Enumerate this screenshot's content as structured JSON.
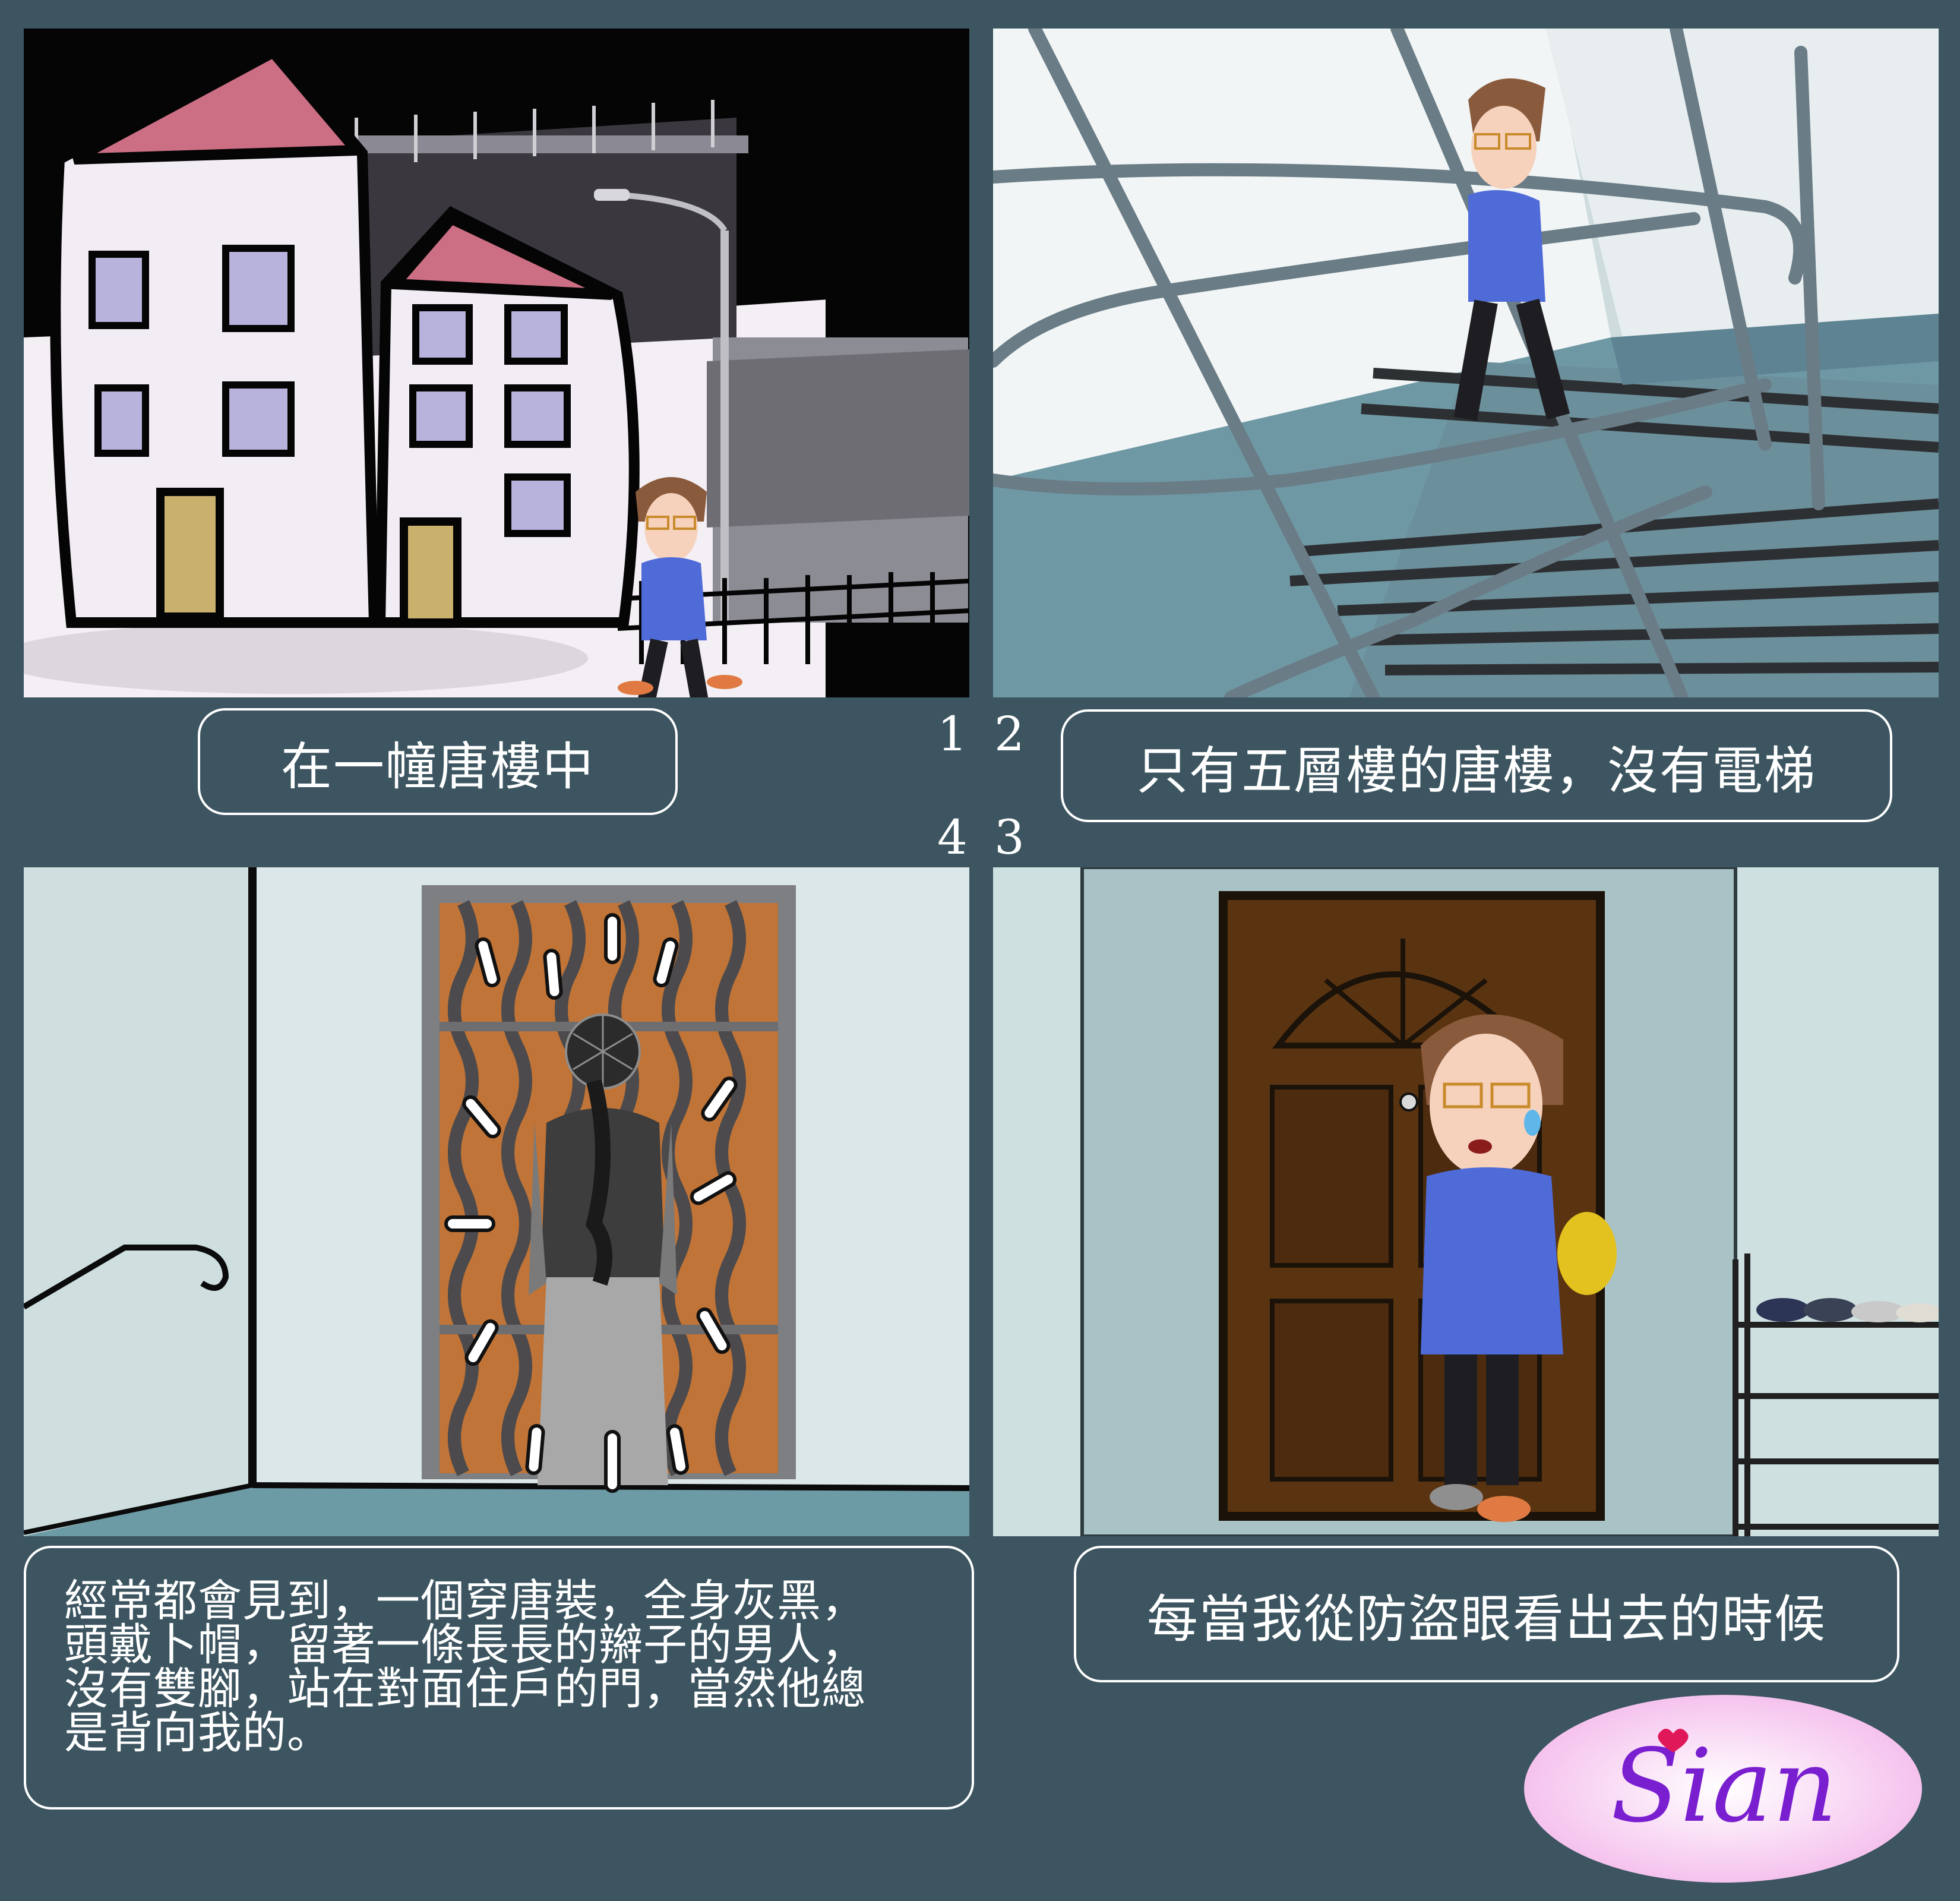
{
  "panel_numbers": [
    "1",
    "2",
    "4",
    "3"
  ],
  "captions": {
    "panel1": "在一幢唐樓中",
    "panel2": "只有五層樓的唐樓，沒有電梯",
    "panel4": "經常都會見到，一個穿唐裝，全身灰黑，\n頭戴卜帽，留著一條長長的辮子的男人，\n沒有雙腳，站在對面住戶的門，當然他總\n是背向我的。",
    "panel3": "每當我從防盜眼看出去的時候"
  },
  "logo": {
    "text": "Sian"
  },
  "colors": {
    "background": "#3c5560",
    "caption_border": "#ffffff",
    "logo_text": "#7a1fd0",
    "logo_bg": "#f3b6ea"
  }
}
